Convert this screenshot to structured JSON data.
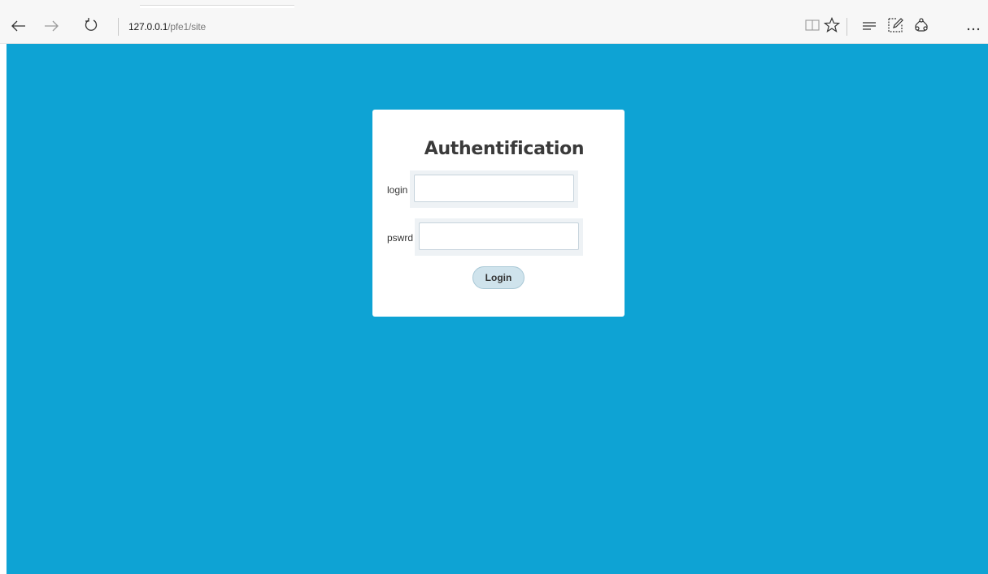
{
  "browser": {
    "address_host": "127.0.0.1",
    "address_path": "/pfe1/site",
    "icons": [
      "back-arrow-icon",
      "forward-arrow-icon",
      "refresh-icon",
      "reading-view-icon",
      "favorite-star-icon",
      "hub-icon",
      "web-note-icon",
      "share-icon",
      "more-icon"
    ]
  },
  "colors": {
    "background": "#0ea3d4",
    "card": "#ffffff",
    "button": "#cfe3ec"
  },
  "login_form": {
    "title": "Authentification",
    "login_label": "login",
    "login_value": "",
    "password_label": "pswrd",
    "password_value": "",
    "submit_label": "Login"
  }
}
